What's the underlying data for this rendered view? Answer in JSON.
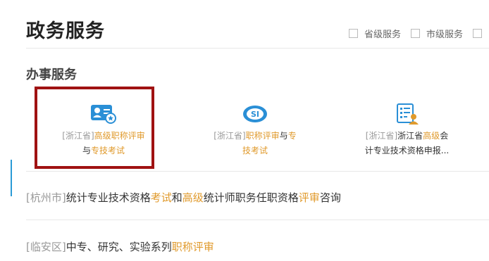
{
  "page": {
    "title": "政务服务"
  },
  "filters": [
    {
      "label": "省级服务",
      "checked": false
    },
    {
      "label": "市级服务",
      "checked": false
    }
  ],
  "section": {
    "title": "办事服务"
  },
  "services": [
    {
      "icon": "id-card-icon",
      "region": "[浙江省]",
      "name_a": "高级职称评审",
      "name_b": "与",
      "name_c": "专技考试"
    },
    {
      "icon": "social-security-icon",
      "region": "[浙江省]",
      "name_a": "职称评审",
      "name_b": "与",
      "name_c": "专",
      "name_d": "技考试"
    },
    {
      "icon": "qualification-form-icon",
      "region": "[浙江省]",
      "name_a": "浙江省",
      "name_b": "高级",
      "name_c": "会",
      "name_d": "计专业技术资格申报..."
    }
  ],
  "news": [
    {
      "region": "[杭州市]",
      "p1": "统计专业技术资格",
      "p2": "考试",
      "p3": "和",
      "p4": "高级",
      "p5": "统计师职务任职资格",
      "p6": "评审",
      "p7": "咨询"
    },
    {
      "region": "[临安区]",
      "p1": "中专、研究、实验系列",
      "p2": "职称评审"
    }
  ],
  "colors": {
    "accent_orange": "#e09a2c",
    "icon_blue": "#2a8fd6",
    "highlight_red": "#a01212"
  }
}
